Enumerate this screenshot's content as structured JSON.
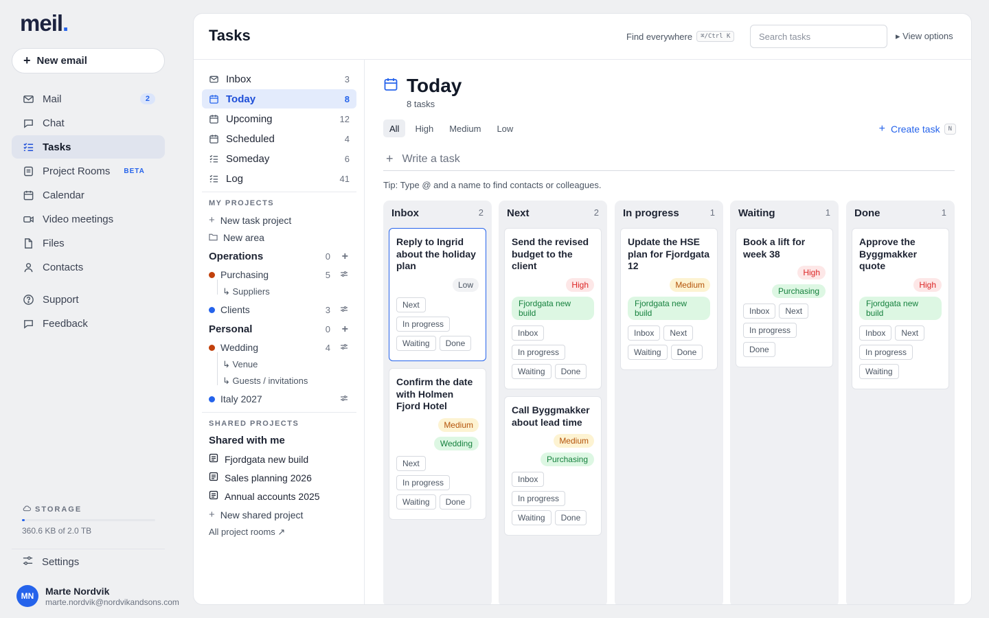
{
  "app": {
    "logo_text": "meil",
    "accent_color": "#2563eb",
    "new_email_label": "New email"
  },
  "nav": [
    {
      "label": "Mail",
      "icon": "mail-icon",
      "badge": "2"
    },
    {
      "label": "Chat",
      "icon": "chat-icon"
    },
    {
      "label": "Tasks",
      "icon": "tasks-icon",
      "active": true
    },
    {
      "label": "Project Rooms",
      "icon": "project-rooms-icon",
      "tag": "BETA"
    },
    {
      "label": "Calendar",
      "icon": "calendar-icon"
    },
    {
      "label": "Video meetings",
      "icon": "video-icon"
    },
    {
      "label": "Files",
      "icon": "file-icon"
    },
    {
      "label": "Contacts",
      "icon": "contacts-icon"
    },
    {
      "label": "Support",
      "icon": "help-icon"
    },
    {
      "label": "Feedback",
      "icon": "feedback-icon"
    }
  ],
  "storage": {
    "label": "STORAGE",
    "used_text": "360.6 KB of 2.0 TB",
    "used_fraction": 0.02
  },
  "settings_label": "Settings",
  "user": {
    "initials": "MN",
    "name": "Marte Nordvik",
    "email": "marte.nordvik@nordvikandsons.com"
  },
  "header": {
    "title": "Tasks",
    "find_label": "Find everywhere",
    "find_shortcut": "⌘/Ctrl K",
    "search_placeholder": "Search tasks",
    "view_options_label": "▸ View options"
  },
  "lists": [
    {
      "label": "Inbox",
      "count": "3",
      "icon": "inbox-icon"
    },
    {
      "label": "Today",
      "count": "8",
      "icon": "calendar-icon",
      "active": true
    },
    {
      "label": "Upcoming",
      "count": "12",
      "icon": "calendar-icon"
    },
    {
      "label": "Scheduled",
      "count": "4",
      "icon": "calendar-icon"
    },
    {
      "label": "Someday",
      "count": "6",
      "icon": "list-icon"
    },
    {
      "label": "Log",
      "count": "41",
      "icon": "list-icon"
    }
  ],
  "my_projects": {
    "label": "MY PROJECTS",
    "new_task_project": "New task project",
    "new_area": "New area",
    "groups": [
      {
        "name": "Operations",
        "count": "0",
        "projects": [
          {
            "name": "Purchasing",
            "count": "5",
            "color": "#c2410c",
            "subs": [
              "↳ Suppliers"
            ]
          },
          {
            "name": "Clients",
            "count": "3",
            "color": "#2563eb",
            "subs": []
          }
        ]
      },
      {
        "name": "Personal",
        "count": "0",
        "projects": [
          {
            "name": "Wedding",
            "count": "4",
            "color": "#c2410c",
            "subs": [
              "↳ Venue",
              "↳ Guests / invitations"
            ]
          },
          {
            "name": "Italy 2027",
            "count": "",
            "color": "#2563eb",
            "subs": []
          }
        ]
      }
    ]
  },
  "shared_projects": {
    "label": "SHARED PROJECTS",
    "shared_with_me": "Shared with me",
    "items": [
      "Fjordgata new build",
      "Sales planning 2026",
      "Annual accounts 2025"
    ],
    "new_shared": "New shared project",
    "all_rooms": "All project rooms ↗"
  },
  "board": {
    "title": "Today",
    "task_count": "8 tasks",
    "filters": [
      "All",
      "High",
      "Medium",
      "Low"
    ],
    "active_filter": "All",
    "create_task_label": "Create task",
    "create_task_shortcut": "N",
    "write_placeholder": "Write a task",
    "tip": "Tip: Type @ and a name to find contacts or colleagues.",
    "columns": [
      {
        "name": "Inbox",
        "count": "2",
        "cards": [
          {
            "title": "Reply to Ingrid about the holiday plan",
            "priority": "Low",
            "project": "",
            "moves": [
              "Next",
              "In progress",
              "Waiting",
              "Done"
            ],
            "selected": true
          },
          {
            "title": "Confirm the date with Holmen Fjord Hotel",
            "priority": "Medium",
            "project": "Wedding",
            "moves": [
              "Next",
              "In progress",
              "Waiting",
              "Done"
            ]
          }
        ]
      },
      {
        "name": "Next",
        "count": "2",
        "cards": [
          {
            "title": "Send the revised budget to the client",
            "priority": "High",
            "project": "Fjordgata new build",
            "moves": [
              "Inbox",
              "In progress",
              "Waiting",
              "Done"
            ]
          },
          {
            "title": "Call Byggmakker about lead time",
            "priority": "Medium",
            "project": "Purchasing",
            "moves": [
              "Inbox",
              "In progress",
              "Waiting",
              "Done"
            ]
          }
        ]
      },
      {
        "name": "In progress",
        "count": "1",
        "cards": [
          {
            "title": "Update the HSE plan for Fjordgata 12",
            "priority": "Medium",
            "project": "Fjordgata new build",
            "moves": [
              "Inbox",
              "Next",
              "Waiting",
              "Done"
            ]
          }
        ]
      },
      {
        "name": "Waiting",
        "count": "1",
        "cards": [
          {
            "title": "Book a lift for week 38",
            "priority": "High",
            "project": "Purchasing",
            "moves": [
              "Inbox",
              "Next",
              "In progress",
              "Done"
            ]
          }
        ]
      },
      {
        "name": "Done",
        "count": "1",
        "cards": [
          {
            "title": "Approve the Byggmakker quote",
            "priority": "High",
            "project": "Fjordgata new build",
            "moves": [
              "Inbox",
              "Next",
              "In progress",
              "Waiting"
            ]
          }
        ]
      }
    ]
  }
}
